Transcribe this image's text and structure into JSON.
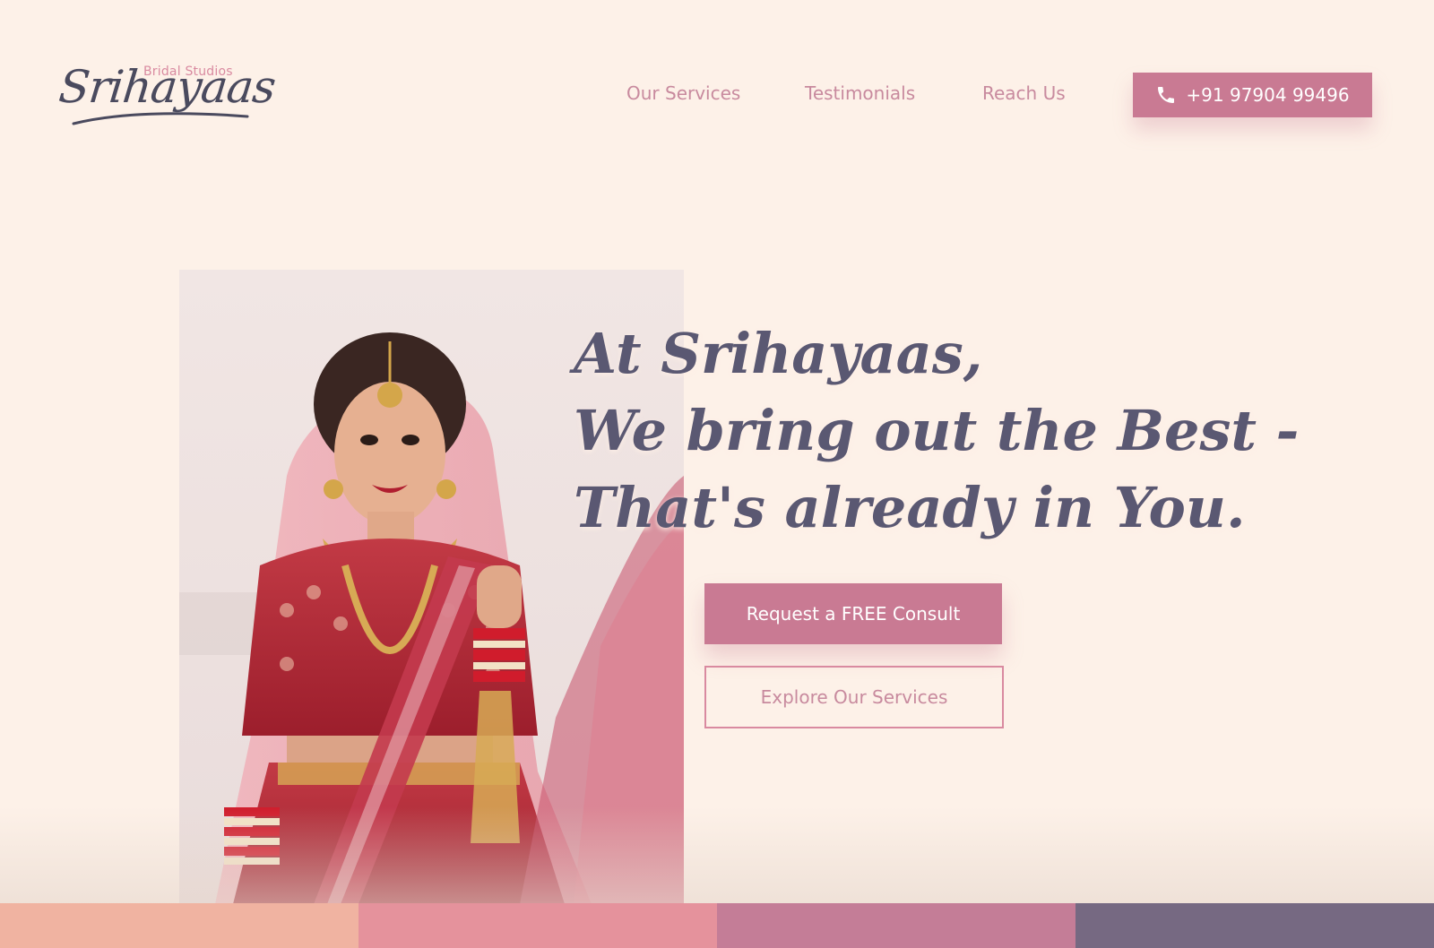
{
  "logo": {
    "subtitle": "Bridal Studios",
    "name": "Srihayaas"
  },
  "nav": {
    "links": [
      {
        "label": "Our Services"
      },
      {
        "label": "Testimonials"
      },
      {
        "label": "Reach Us"
      }
    ],
    "phone": {
      "icon": "phone-icon",
      "label": "+91 97904 99496"
    }
  },
  "hero": {
    "heading_lines": [
      "At Srihayaas,",
      "We bring out the Best -",
      "That's already in You."
    ],
    "primary_cta": "Request a FREE Consult",
    "secondary_cta": "Explore Our Services",
    "image": "bride-photo"
  },
  "colors": {
    "accent": "#c97a93",
    "heading": "#5a5872",
    "background": "#fdf1e8",
    "band": [
      "#f0b3a1",
      "#e5929c",
      "#c47d97",
      "#766982"
    ]
  }
}
